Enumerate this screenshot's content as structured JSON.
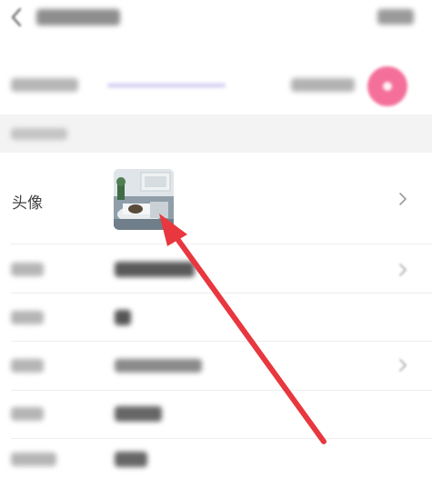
{
  "profile": {
    "avatar_label": "头像"
  },
  "colors": {
    "accent_pink": "#f4709a",
    "annotation_arrow": "#e8373f",
    "section_bg": "#f3f3f3",
    "divider": "#ededed"
  },
  "icons": {
    "back": "chevron-left-icon",
    "row_chevron": "chevron-right-icon",
    "badge": "pink-circle-badge-icon"
  }
}
